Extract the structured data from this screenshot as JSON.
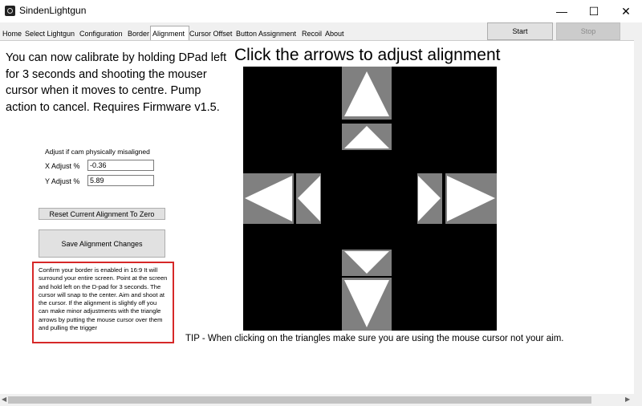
{
  "window": {
    "title": "SindenLightgun",
    "minimize_glyph": "—",
    "maximize_glyph": "☐",
    "close_glyph": "✕"
  },
  "tabs": [
    {
      "label": "Home"
    },
    {
      "label": "Select Lightgun"
    },
    {
      "label": "Configuration"
    },
    {
      "label": "Border"
    },
    {
      "label": "Alignment",
      "active": true
    },
    {
      "label": "Cursor Offset"
    },
    {
      "label": "Button Assignment"
    },
    {
      "label": "Recoil"
    },
    {
      "label": "About"
    }
  ],
  "toolbar": {
    "start_label": "Start",
    "stop_label": "Stop"
  },
  "alignment": {
    "instructions": "You can now calibrate by holding DPad left for 3 seconds and shooting the mouser cursor when it moves to centre.  Pump action to cancel. Requires Firmware v1.5.",
    "heading": "Click the arrows to adjust alignment",
    "adjust_caption": "Adjust if cam physically misaligned",
    "x_label": "X Adjust %",
    "x_value": "-0.36",
    "y_label": "Y Adjust %",
    "y_value": "5.89",
    "reset_label": "Reset Current Alignment To Zero",
    "save_label": "Save Alignment Changes",
    "help_text": "Confirm your border is enabled in 16:9 It will surround your entire screen. Point at the screen and hold left on the D-pad for 3 seconds. The cursor will snap to the center. Aim and shoot at the cursor. If the alignment is slightly off you can make minor adjustments with the triangle arrows by putting the mouse cursor over them and pulling the trigger",
    "tip": "TIP - When clicking on the triangles make sure you are using the mouse cursor not your aim."
  },
  "colors": {
    "help_border": "#d62828",
    "pad_background": "#000000",
    "arrow_tile": "#808080",
    "arrow_fill": "#ffffff"
  }
}
